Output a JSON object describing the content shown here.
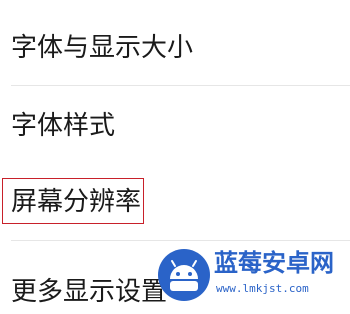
{
  "settings": {
    "items": [
      {
        "label": "字体与显示大小"
      },
      {
        "label": "字体样式"
      },
      {
        "label": "屏幕分辨率"
      },
      {
        "label": "更多显示设置"
      }
    ]
  },
  "watermark": {
    "title": "蓝莓安卓网",
    "url": "www.lmkjst.com"
  },
  "colors": {
    "highlight_border": "#c8202a",
    "watermark_blue": "#2a63c8",
    "text": "#1a1a1a",
    "divider": "#e6e6e6"
  }
}
